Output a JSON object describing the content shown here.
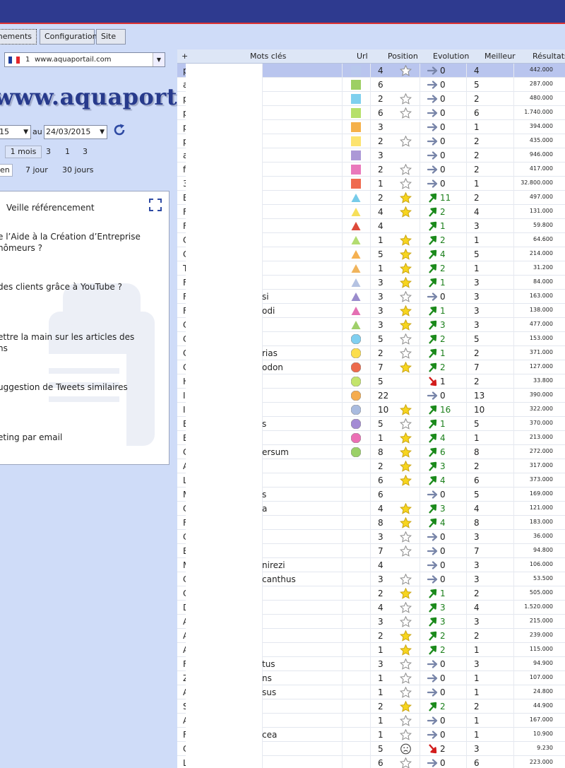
{
  "tabs": [
    "Abonnements",
    "Configuration",
    "Site"
  ],
  "site_select": {
    "number": "1",
    "url": "www.aquaportail.com",
    "flag_colors": [
      "#1d3d9c",
      "#ffffff",
      "#e3262b"
    ]
  },
  "logo": "www.aquaportail.com",
  "date_filter": {
    "from": "15",
    "separator": "au",
    "to": "24/03/2015"
  },
  "periods_row1": [
    "1 mois",
    "3",
    "1",
    "3"
  ],
  "periods_row2": [
    "en",
    "7 jour",
    "30 jours"
  ],
  "veille": {
    "title": "Veille référencement",
    "news": [
      [
        "e l’Aide à la Création d’Entreprise",
        "hômeurs ?"
      ],
      [
        "des clients grâce à YouTube ?"
      ],
      [
        "ettre la main sur les articles des",
        "ns"
      ],
      [
        "uggestion de Tweets similaires"
      ],
      [
        "eting par email"
      ]
    ]
  },
  "table": {
    "headers": {
      "add": "+",
      "keywords": "Mots clés",
      "url": "Url",
      "position": "Position",
      "evolution": "Evolution",
      "best": "Meilleur",
      "results": "Résultats"
    },
    "colors": {
      "green_arrow": "#1b8a1b",
      "red_arrow": "#d21c1c",
      "grey_arrow": "#7784a8",
      "star_gold": "#f7d51e",
      "selection": "#b9c5ee"
    },
    "rows": [
      {
        "kw": "p",
        "tail": "",
        "url": "square:#b8c8ec",
        "pos": "4",
        "star": "empty",
        "dir": "right",
        "evo": "0",
        "best": "4",
        "res": "442.000"
      },
      {
        "kw": "a",
        "tail": "",
        "url": "square:#9dcf63",
        "pos": "6",
        "star": "none",
        "dir": "right",
        "evo": "0",
        "best": "5",
        "res": "287.000"
      },
      {
        "kw": "p",
        "tail": "",
        "url": "square:#7fd0ee",
        "pos": "2",
        "star": "empty",
        "dir": "right",
        "evo": "0",
        "best": "2",
        "res": "480.000"
      },
      {
        "kw": "p",
        "tail": "",
        "url": "square:#b6e06a",
        "pos": "6",
        "star": "empty",
        "dir": "right",
        "evo": "0",
        "best": "6",
        "res": "1.740.000"
      },
      {
        "kw": "p",
        "tail": "",
        "url": "square:#f5b14a",
        "pos": "3",
        "star": "none",
        "dir": "right",
        "evo": "0",
        "best": "1",
        "res": "394.000"
      },
      {
        "kw": "p",
        "tail": "",
        "url": "square:#fce36e",
        "pos": "2",
        "star": "empty",
        "dir": "right",
        "evo": "0",
        "best": "2",
        "res": "435.000"
      },
      {
        "kw": "a",
        "tail": "",
        "url": "square:#ac98d6",
        "pos": "3",
        "star": "none",
        "dir": "right",
        "evo": "0",
        "best": "2",
        "res": "946.000"
      },
      {
        "kw": "f",
        "tail": "",
        "url": "square:#e978bb",
        "pos": "2",
        "star": "empty",
        "dir": "right",
        "evo": "0",
        "best": "2",
        "res": "417.000"
      },
      {
        "kw": "3",
        "tail": "",
        "url": "square:#ef6a4f",
        "pos": "1",
        "star": "empty",
        "dir": "right",
        "evo": "0",
        "best": "1",
        "res": "32.800.000"
      },
      {
        "kw": "E",
        "tail": "",
        "url": "triangle:#76cbe9",
        "pos": "2",
        "star": "gold",
        "dir": "up",
        "evo": "11",
        "best": "2",
        "res": "497.000"
      },
      {
        "kw": "F",
        "tail": "",
        "url": "triangle:#f6df5a",
        "pos": "4",
        "star": "gold",
        "dir": "up",
        "evo": "2",
        "best": "4",
        "res": "131.000"
      },
      {
        "kw": "F",
        "tail": "",
        "url": "triangle:#dd4a3a",
        "pos": "4",
        "star": "none",
        "dir": "up",
        "evo": "1",
        "best": "3",
        "res": "59.800"
      },
      {
        "kw": "C",
        "tail": "",
        "url": "triangle:#b3dc70",
        "pos": "1",
        "star": "gold",
        "dir": "up",
        "evo": "2",
        "best": "1",
        "res": "64.600"
      },
      {
        "kw": "C",
        "tail": "",
        "url": "triangle:#f5b050",
        "pos": "5",
        "star": "gold",
        "dir": "up",
        "evo": "4",
        "best": "5",
        "res": "214.000"
      },
      {
        "kw": "T",
        "tail": "",
        "url": "triangle:#f0b45c",
        "pos": "1",
        "star": "gold",
        "dir": "up",
        "evo": "2",
        "best": "1",
        "res": "31.200"
      },
      {
        "kw": "F",
        "tail": "",
        "url": "triangle:#b4c2e2",
        "pos": "3",
        "star": "gold",
        "dir": "up",
        "evo": "1",
        "best": "3",
        "res": "84.000"
      },
      {
        "kw": "F",
        "tail": "si",
        "url": "triangle:#9a8ccc",
        "pos": "3",
        "star": "empty",
        "dir": "right",
        "evo": "0",
        "best": "3",
        "res": "163.000"
      },
      {
        "kw": "F",
        "tail": "odi",
        "url": "triangle:#e46fb3",
        "pos": "3",
        "star": "gold",
        "dir": "up",
        "evo": "1",
        "best": "3",
        "res": "138.000"
      },
      {
        "kw": "C",
        "tail": "",
        "url": "triangle:#9fcf6a",
        "pos": "3",
        "star": "gold",
        "dir": "up",
        "evo": "3",
        "best": "3",
        "res": "477.000"
      },
      {
        "kw": "C",
        "tail": "",
        "url": "circle:#7fcff0",
        "pos": "5",
        "star": "empty",
        "dir": "up",
        "evo": "2",
        "best": "5",
        "res": "153.000"
      },
      {
        "kw": "C",
        "tail": "rias",
        "url": "circle:#fbde4c",
        "pos": "2",
        "star": "empty",
        "dir": "up",
        "evo": "1",
        "best": "2",
        "res": "371.000"
      },
      {
        "kw": "C",
        "tail": "odon",
        "url": "circle:#ed6a4c",
        "pos": "7",
        "star": "gold",
        "dir": "up",
        "evo": "2",
        "best": "7",
        "res": "127.000"
      },
      {
        "kw": "H",
        "tail": "",
        "url": "circle:#c3e46b",
        "pos": "5",
        "star": "none",
        "dir": "down",
        "evo": "1",
        "best": "2",
        "res": "33.800"
      },
      {
        "kw": "I",
        "tail": "",
        "url": "circle:#f5ac4e",
        "pos": "22",
        "star": "none",
        "dir": "right",
        "evo": "0",
        "best": "13",
        "res": "390.000"
      },
      {
        "kw": "I",
        "tail": "",
        "url": "circle:#a9bbdf",
        "pos": "10",
        "star": "gold",
        "dir": "up",
        "evo": "16",
        "best": "10",
        "res": "322.000"
      },
      {
        "kw": "E",
        "tail": "s",
        "url": "circle:#a48bd4",
        "pos": "5",
        "star": "empty",
        "dir": "up",
        "evo": "1",
        "best": "5",
        "res": "370.000"
      },
      {
        "kw": "E",
        "tail": "",
        "url": "circle:#ec6fb5",
        "pos": "1",
        "star": "gold",
        "dir": "up",
        "evo": "4",
        "best": "1",
        "res": "213.000"
      },
      {
        "kw": "C",
        "tail": "ersum",
        "url": "circle:#9ad067",
        "pos": "8",
        "star": "gold",
        "dir": "up",
        "evo": "6",
        "best": "8",
        "res": "272.000"
      },
      {
        "kw": "A",
        "tail": "",
        "url": "none",
        "pos": "2",
        "star": "gold",
        "dir": "up",
        "evo": "3",
        "best": "2",
        "res": "317.000"
      },
      {
        "kw": "L",
        "tail": "",
        "url": "none",
        "pos": "6",
        "star": "gold",
        "dir": "up",
        "evo": "4",
        "best": "6",
        "res": "373.000"
      },
      {
        "kw": "M",
        "tail": "s",
        "url": "none",
        "pos": "6",
        "star": "none",
        "dir": "right",
        "evo": "0",
        "best": "5",
        "res": "169.000"
      },
      {
        "kw": "C",
        "tail": "a",
        "url": "none",
        "pos": "4",
        "star": "gold",
        "dir": "up",
        "evo": "3",
        "best": "4",
        "res": "121.000"
      },
      {
        "kw": "F",
        "tail": "",
        "url": "none",
        "pos": "8",
        "star": "gold",
        "dir": "up",
        "evo": "4",
        "best": "8",
        "res": "183.000"
      },
      {
        "kw": "C",
        "tail": "",
        "url": "none",
        "pos": "3",
        "star": "empty",
        "dir": "right",
        "evo": "0",
        "best": "3",
        "res": "36.000"
      },
      {
        "kw": "E",
        "tail": "",
        "url": "none",
        "pos": "7",
        "star": "empty",
        "dir": "right",
        "evo": "0",
        "best": "7",
        "res": "94.800"
      },
      {
        "kw": "M",
        "tail": "nirezi",
        "url": "none",
        "pos": "4",
        "star": "none",
        "dir": "right",
        "evo": "0",
        "best": "3",
        "res": "106.000"
      },
      {
        "kw": "C",
        "tail": "canthus",
        "url": "none",
        "pos": "3",
        "star": "empty",
        "dir": "right",
        "evo": "0",
        "best": "3",
        "res": "53.500"
      },
      {
        "kw": "C",
        "tail": "",
        "url": "none",
        "pos": "2",
        "star": "gold",
        "dir": "up",
        "evo": "1",
        "best": "2",
        "res": "505.000"
      },
      {
        "kw": "D",
        "tail": "",
        "url": "none",
        "pos": "4",
        "star": "empty",
        "dir": "up",
        "evo": "3",
        "best": "4",
        "res": "1.520.000"
      },
      {
        "kw": "A",
        "tail": "",
        "url": "none",
        "pos": "3",
        "star": "empty",
        "dir": "up",
        "evo": "3",
        "best": "3",
        "res": "215.000"
      },
      {
        "kw": "A",
        "tail": "",
        "url": "none",
        "pos": "2",
        "star": "gold",
        "dir": "up",
        "evo": "2",
        "best": "2",
        "res": "239.000"
      },
      {
        "kw": "A",
        "tail": "",
        "url": "none",
        "pos": "1",
        "star": "gold",
        "dir": "up",
        "evo": "2",
        "best": "1",
        "res": "115.000"
      },
      {
        "kw": "F",
        "tail": "tus",
        "url": "none",
        "pos": "3",
        "star": "empty",
        "dir": "right",
        "evo": "0",
        "best": "3",
        "res": "94.900"
      },
      {
        "kw": "Z",
        "tail": "ns",
        "url": "none",
        "pos": "1",
        "star": "empty",
        "dir": "right",
        "evo": "0",
        "best": "1",
        "res": "107.000"
      },
      {
        "kw": "A",
        "tail": "sus",
        "url": "none",
        "pos": "1",
        "star": "empty",
        "dir": "right",
        "evo": "0",
        "best": "1",
        "res": "24.800"
      },
      {
        "kw": "S",
        "tail": "",
        "url": "none",
        "pos": "2",
        "star": "gold",
        "dir": "up",
        "evo": "2",
        "best": "2",
        "res": "44.900"
      },
      {
        "kw": "A",
        "tail": "",
        "url": "none",
        "pos": "1",
        "star": "empty",
        "dir": "right",
        "evo": "0",
        "best": "1",
        "res": "167.000"
      },
      {
        "kw": "F",
        "tail": "cea",
        "url": "none",
        "pos": "1",
        "star": "empty",
        "dir": "right",
        "evo": "0",
        "best": "1",
        "res": "10.900"
      },
      {
        "kw": "C",
        "tail": "",
        "url": "none",
        "pos": "5",
        "star": "sad",
        "dir": "down",
        "evo": "2",
        "best": "3",
        "res": "9.230"
      },
      {
        "kw": "L",
        "tail": "",
        "url": "none",
        "pos": "6",
        "star": "empty",
        "dir": "right",
        "evo": "0",
        "best": "6",
        "res": "223.000"
      }
    ]
  }
}
